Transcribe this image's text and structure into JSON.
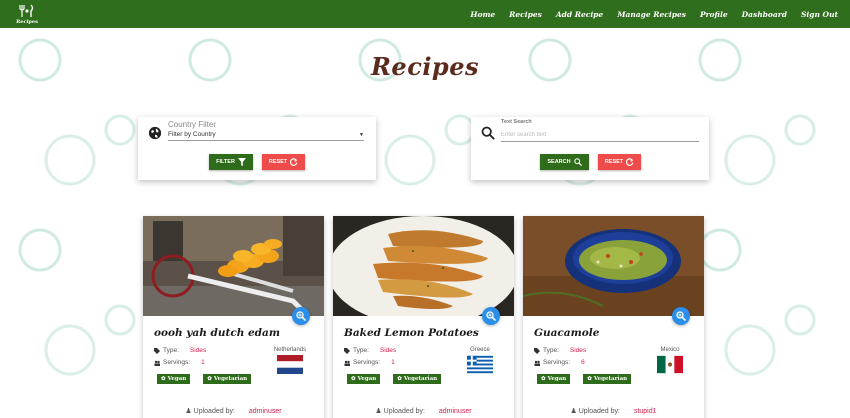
{
  "brand": {
    "label": "Recipes"
  },
  "nav": {
    "items": [
      {
        "label": "Home"
      },
      {
        "label": "Recipes"
      },
      {
        "label": "Add Recipe"
      },
      {
        "label": "Manage Recipes"
      },
      {
        "label": "Profile"
      },
      {
        "label": "Dashboard"
      },
      {
        "label": "Sign Out"
      }
    ]
  },
  "page": {
    "title": "Recipes"
  },
  "country_filter": {
    "label": "Country Filter",
    "selected": "Filter by Country",
    "filter_button": "FILTER",
    "reset_button": "RESET"
  },
  "text_search": {
    "label": "Text Search",
    "placeholder": "Enter search text",
    "search_button": "SEARCH",
    "reset_button": "RESET"
  },
  "recipes": [
    {
      "title": "oooh yah dutch edam",
      "type_label": "Type:",
      "type": "Sides",
      "servings_label": "Servings:",
      "servings": "1",
      "country": "Netherlands",
      "tags": [
        "Vegan",
        "Vegetarian"
      ],
      "uploaded_label": "Uploaded by:",
      "uploader": "adminuser"
    },
    {
      "title": "Baked Lemon Potatoes",
      "type_label": "Type:",
      "type": "Sides",
      "servings_label": "Servings:",
      "servings": "1",
      "country": "Greece",
      "tags": [
        "Vegan",
        "Vegetarian"
      ],
      "uploaded_label": "Uploaded by:",
      "uploader": "adminuser"
    },
    {
      "title": "Guacamole",
      "type_label": "Type:",
      "type": "Sides",
      "servings_label": "Servings:",
      "servings": "6",
      "country": "Mexico",
      "tags": [
        "Vegan",
        "Vegetarian"
      ],
      "uploaded_label": "Uploaded by:",
      "uploader": "stupid1"
    }
  ],
  "colors": {
    "navbar": "#2f6e1c",
    "title": "#5a2a1c",
    "primary_button": "#2e6b1b",
    "reset_button": "#ef4b4b",
    "accent_text": "#d61f4a",
    "zoom_button": "#2b8ee8"
  }
}
